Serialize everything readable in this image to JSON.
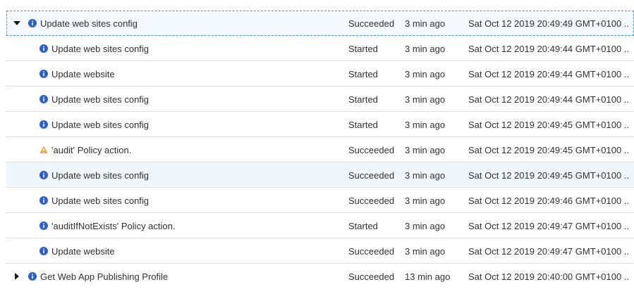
{
  "rows": [
    {
      "name": "Update web sites config",
      "status": "Succeeded",
      "time": "3 min ago",
      "timestamp": "Sat Oct 12 2019 20:49:49 GMT+0100 ...",
      "icon": "info-icon"
    },
    {
      "name": "Update web sites config",
      "status": "Started",
      "time": "3 min ago",
      "timestamp": "Sat Oct 12 2019 20:49:44 GMT+0100 ...",
      "icon": "info-icon"
    },
    {
      "name": "Update website",
      "status": "Started",
      "time": "3 min ago",
      "timestamp": "Sat Oct 12 2019 20:49:44 GMT+0100 ...",
      "icon": "info-icon"
    },
    {
      "name": "Update web sites config",
      "status": "Started",
      "time": "3 min ago",
      "timestamp": "Sat Oct 12 2019 20:49:44 GMT+0100 ...",
      "icon": "info-icon"
    },
    {
      "name": "Update web sites config",
      "status": "Started",
      "time": "3 min ago",
      "timestamp": "Sat Oct 12 2019 20:49:45 GMT+0100 ...",
      "icon": "info-icon"
    },
    {
      "name": "'audit' Policy action.",
      "status": "Succeeded",
      "time": "3 min ago",
      "timestamp": "Sat Oct 12 2019 20:49:45 GMT+0100 ...",
      "icon": "warning-icon"
    },
    {
      "name": "Update web sites config",
      "status": "Succeeded",
      "time": "3 min ago",
      "timestamp": "Sat Oct 12 2019 20:49:45 GMT+0100 ...",
      "icon": "info-icon"
    },
    {
      "name": "Update web sites config",
      "status": "Succeeded",
      "time": "3 min ago",
      "timestamp": "Sat Oct 12 2019 20:49:46 GMT+0100 ...",
      "icon": "info-icon"
    },
    {
      "name": "'auditIfNotExists' Policy action.",
      "status": "Started",
      "time": "3 min ago",
      "timestamp": "Sat Oct 12 2019 20:49:47 GMT+0100 ...",
      "icon": "info-icon"
    },
    {
      "name": "Update website",
      "status": "Succeeded",
      "time": "3 min ago",
      "timestamp": "Sat Oct 12 2019 20:49:47 GMT+0100 ...",
      "icon": "info-icon"
    },
    {
      "name": "Get Web App Publishing Profile",
      "status": "Succeeded",
      "time": "13 min ago",
      "timestamp": "Sat Oct 12 2019 20:40:00 GMT+0100 ...",
      "icon": "info-icon"
    }
  ],
  "colors": {
    "info": "#2c5ecf",
    "warning": "#f2a33a",
    "selected_border": "#4a9bd4",
    "hover_bg": "#eff6fc"
  }
}
